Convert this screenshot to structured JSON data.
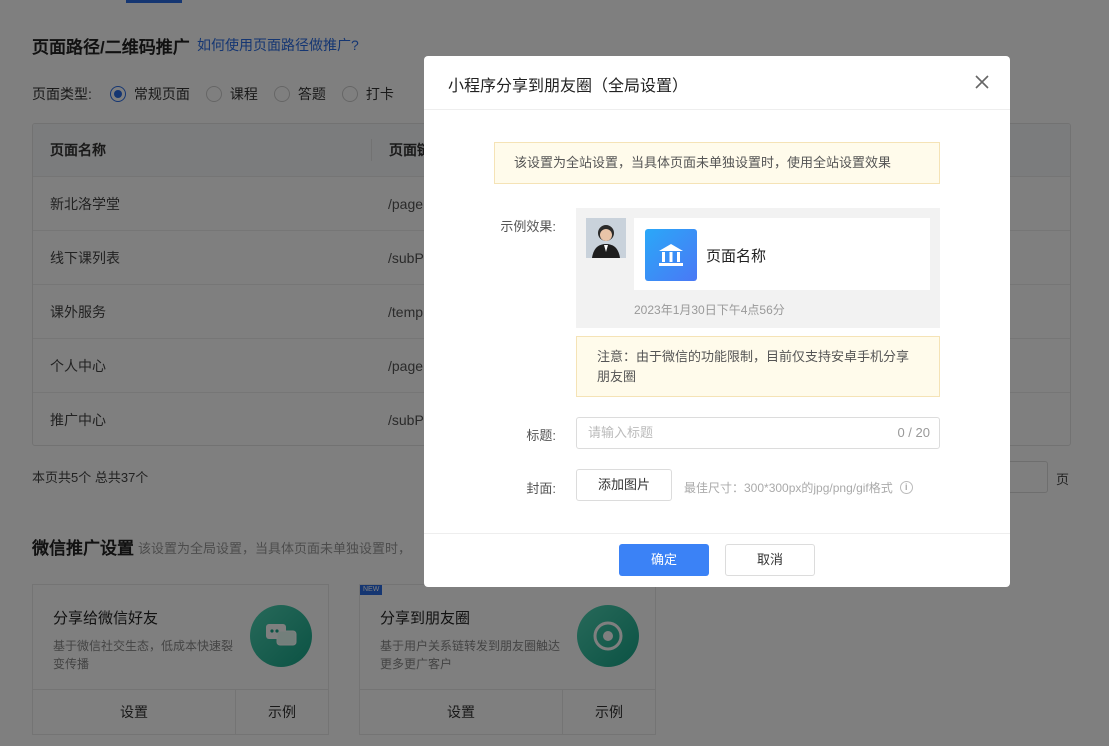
{
  "page": {
    "section_title": "页面路径/二维码推广",
    "help_link": "如何使用页面路径做推广?",
    "type_label": "页面类型:",
    "types": [
      "常规页面",
      "课程",
      "答题",
      "打卡"
    ],
    "table": {
      "headers": [
        "页面名称",
        "页面链"
      ],
      "rows": [
        {
          "name": "新北洛学堂",
          "path": "/page"
        },
        {
          "name": "线下课列表",
          "path": "/subP"
        },
        {
          "name": "课外服务",
          "path": "/temp"
        },
        {
          "name": "个人中心",
          "path": "/page"
        },
        {
          "name": "推广中心",
          "path": "/subP"
        }
      ]
    },
    "count_text": "本页共5个 总共37个",
    "pager_suffix": "页",
    "wx_title": "微信推广设置",
    "wx_desc": "该设置为全局设置，当具体页面未单独设置时，",
    "cards": [
      {
        "title": "分享给微信好友",
        "desc": "基于微信社交生态，低成本快速裂变传播",
        "setup": "设置",
        "example": "示例"
      },
      {
        "title": "分享到朋友圈",
        "desc": "基于用户关系链转发到朋友圈触达更多更广客户",
        "setup": "设置",
        "example": "示例",
        "badge": "NEW"
      }
    ]
  },
  "modal": {
    "title": "小程序分享到朋友圈（全局设置）",
    "notice": "该设置为全站设置，当具体页面未单独设置时，使用全站设置效果",
    "example_label": "示例效果:",
    "preview_name": "页面名称",
    "preview_time": "2023年1月30日下午4点56分",
    "warn": "注意：由于微信的功能限制，目前仅支持安卓手机分享朋友圈",
    "title_label": "标题:",
    "title_placeholder": "请输入标题",
    "title_count": "0 / 20",
    "cover_label": "封面:",
    "add_image": "添加图片",
    "cover_hint": "最佳尺寸：300*300px的jpg/png/gif格式",
    "ok": "确定",
    "cancel": "取消"
  },
  "colors": {
    "accent": "#2b6de5",
    "primary_button": "#3b82f6",
    "notice_bg": "#fffbeb"
  }
}
